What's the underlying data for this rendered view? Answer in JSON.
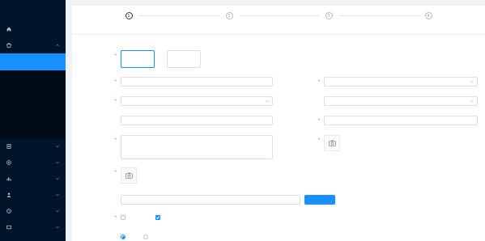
{
  "logo": "",
  "sidebar": {
    "items": [
      {
        "label": "",
        "icon": "home-icon",
        "expanded": false
      },
      {
        "label": "",
        "icon": "product-icon",
        "expanded": true,
        "children": [
          {
            "label": "",
            "active": true
          },
          {
            "label": "",
            "active": false
          },
          {
            "label": "",
            "active": false
          },
          {
            "label": "",
            "active": false
          },
          {
            "label": "",
            "active": false
          }
        ]
      },
      {
        "label": "",
        "icon": "order-icon",
        "expanded": false
      },
      {
        "label": "",
        "icon": "marketing-icon",
        "expanded": false
      },
      {
        "label": "",
        "icon": "finance-icon",
        "expanded": false
      },
      {
        "label": "",
        "icon": "user-icon",
        "expanded": false
      },
      {
        "label": "",
        "icon": "one-stop-icon",
        "expanded": false
      },
      {
        "label": "",
        "icon": "delivery-icon",
        "expanded": false
      }
    ]
  },
  "steps": [
    {
      "number": "1",
      "label": "",
      "active": true
    },
    {
      "number": "2",
      "label": "",
      "active": false
    },
    {
      "number": "3",
      "label": "",
      "active": false
    },
    {
      "number": "4",
      "label": "",
      "active": false
    }
  ],
  "form": {
    "product_type": {
      "label": "",
      "options": [
        {
          "title": "",
          "subtitle": "",
          "selected": true
        },
        {
          "title": "",
          "subtitle": "",
          "selected": false
        }
      ]
    },
    "product_name": {
      "label": "",
      "placeholder": ""
    },
    "merchant_category": {
      "label": "",
      "placeholder": ""
    },
    "platform_category": {
      "label": "",
      "placeholder": ""
    },
    "brand": {
      "label": "",
      "placeholder": ""
    },
    "keywords": {
      "label": "",
      "placeholder": ""
    },
    "unit": {
      "label": "",
      "placeholder": ""
    },
    "summary": {
      "label": "",
      "placeholder": ""
    },
    "cover_image": {
      "label": ""
    },
    "carousel_image": {
      "label": ""
    },
    "video": {
      "label": "",
      "placeholder": "",
      "button": ""
    },
    "delivery": {
      "label": "",
      "options": [
        {
          "label": "",
          "checked": false
        },
        {
          "label": "",
          "checked": true
        }
      ]
    },
    "custom_form": {
      "label": "",
      "options": [
        {
          "label": "",
          "checked": true
        },
        {
          "label": "",
          "checked": false
        }
      ]
    }
  },
  "colors": {
    "primary": "#1890ff",
    "sidebar_bg": "#001529",
    "required": "#e33333"
  }
}
